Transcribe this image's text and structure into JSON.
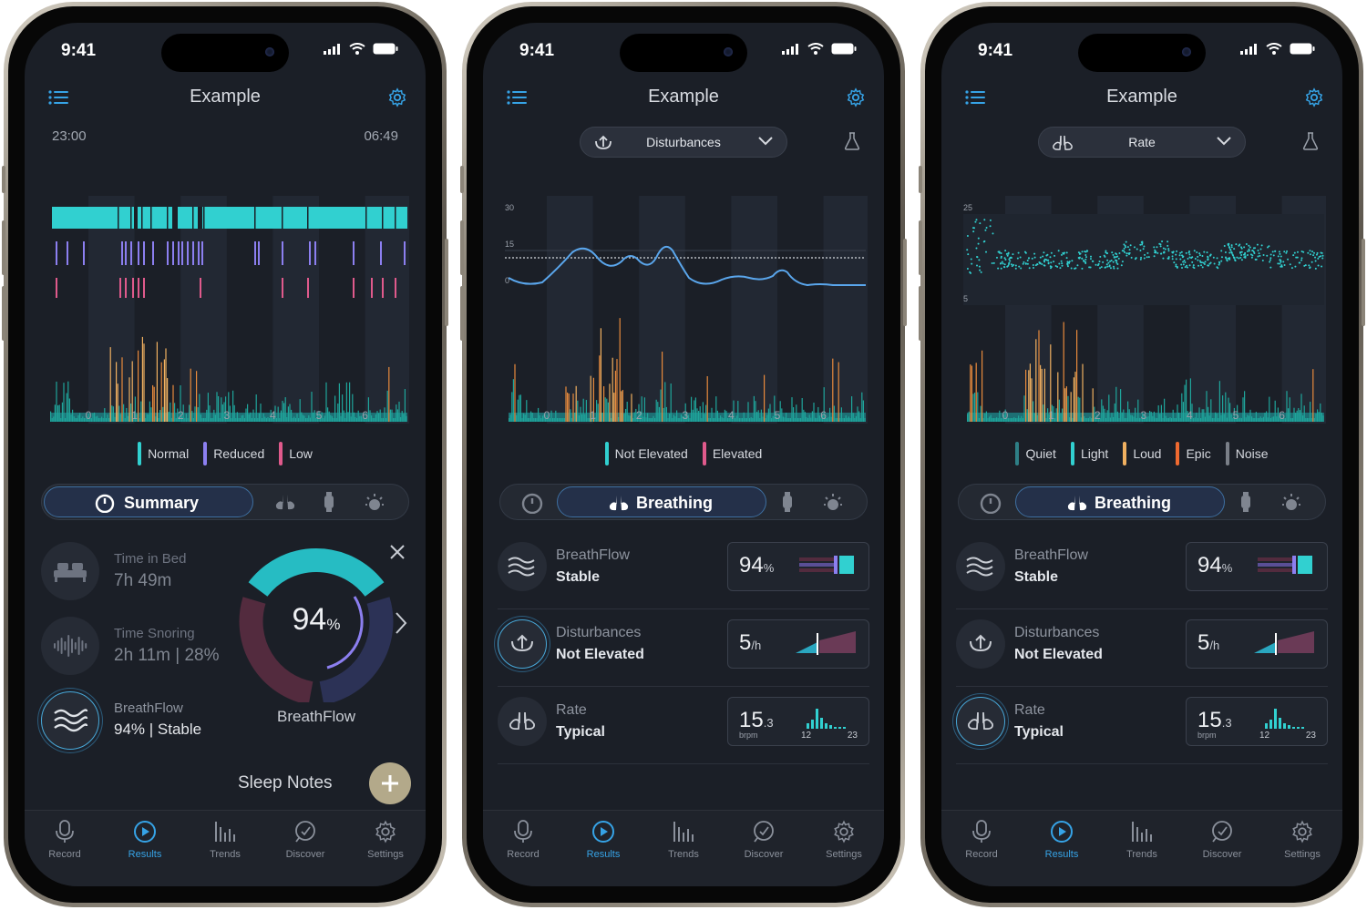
{
  "status": {
    "time": "9:41"
  },
  "app_title": "Example",
  "colors": {
    "accent": "#36a3e6",
    "teal": "#31d0d0",
    "purple": "#8c7ff0",
    "pink": "#e05a8c",
    "orange": "#f08a3c"
  },
  "phone1": {
    "time_start": "23:00",
    "time_end": "06:49",
    "hour_ticks": [
      "0",
      "1",
      "2",
      "3",
      "4",
      "5",
      "6"
    ],
    "legend": [
      {
        "label": "Normal",
        "color": "#31d0d0"
      },
      {
        "label": "Reduced",
        "color": "#8c7ff0"
      },
      {
        "label": "Low",
        "color": "#e05a8c"
      }
    ],
    "active_tab": "Summary",
    "metrics": [
      {
        "label": "Time in Bed",
        "value": "7h 49m",
        "icon": "bed-icon"
      },
      {
        "label": "Time Snoring",
        "value": "2h 11m | 28%",
        "icon": "waveform-icon"
      },
      {
        "label": "BreathFlow",
        "value": "94% | Stable",
        "icon": "waves-icon"
      }
    ],
    "gauge": {
      "value": "94",
      "unit": "%",
      "caption": "BreathFlow"
    },
    "sleep_notes": "Sleep Notes"
  },
  "phone2": {
    "dropdown": "Disturbances",
    "y_ticks": [
      "30",
      "15",
      "0"
    ],
    "hour_ticks": [
      "0",
      "1",
      "2",
      "3",
      "4",
      "5",
      "6"
    ],
    "legend": [
      {
        "label": "Not Elevated",
        "color": "#31d0d0"
      },
      {
        "label": "Elevated",
        "color": "#e05a8c"
      }
    ],
    "active_tab": "Breathing"
  },
  "phone3": {
    "dropdown": "Rate",
    "y_ticks": [
      "25",
      "5"
    ],
    "hour_ticks": [
      "0",
      "1",
      "2",
      "3",
      "4",
      "5",
      "6"
    ],
    "legend": [
      {
        "label": "Quiet",
        "color": "#2e7f86"
      },
      {
        "label": "Light",
        "color": "#31d0d0"
      },
      {
        "label": "Loud",
        "color": "#f0b060"
      },
      {
        "label": "Epic",
        "color": "#f06a30"
      },
      {
        "label": "Noise",
        "color": "#7a7f88"
      }
    ],
    "active_tab": "Breathing"
  },
  "breathing_rows": [
    {
      "title": "BreathFlow",
      "status": "Stable",
      "value": "94",
      "unit": "%",
      "icon": "waves-icon"
    },
    {
      "title": "Disturbances",
      "status": "Not Elevated",
      "value": "5",
      "unit": "/h",
      "icon": "disturbance-icon"
    },
    {
      "title": "Rate",
      "status": "Typical",
      "value": "15",
      "unit": ".3",
      "sub": "brpm",
      "min": "12",
      "max": "23",
      "icon": "lungs-icon"
    }
  ],
  "nav": [
    {
      "label": "Record",
      "icon": "microphone-icon"
    },
    {
      "label": "Results",
      "icon": "play-circle-icon",
      "active": true
    },
    {
      "label": "Trends",
      "icon": "bars-icon"
    },
    {
      "label": "Discover",
      "icon": "compass-icon"
    },
    {
      "label": "Settings",
      "icon": "gear-icon"
    }
  ]
}
